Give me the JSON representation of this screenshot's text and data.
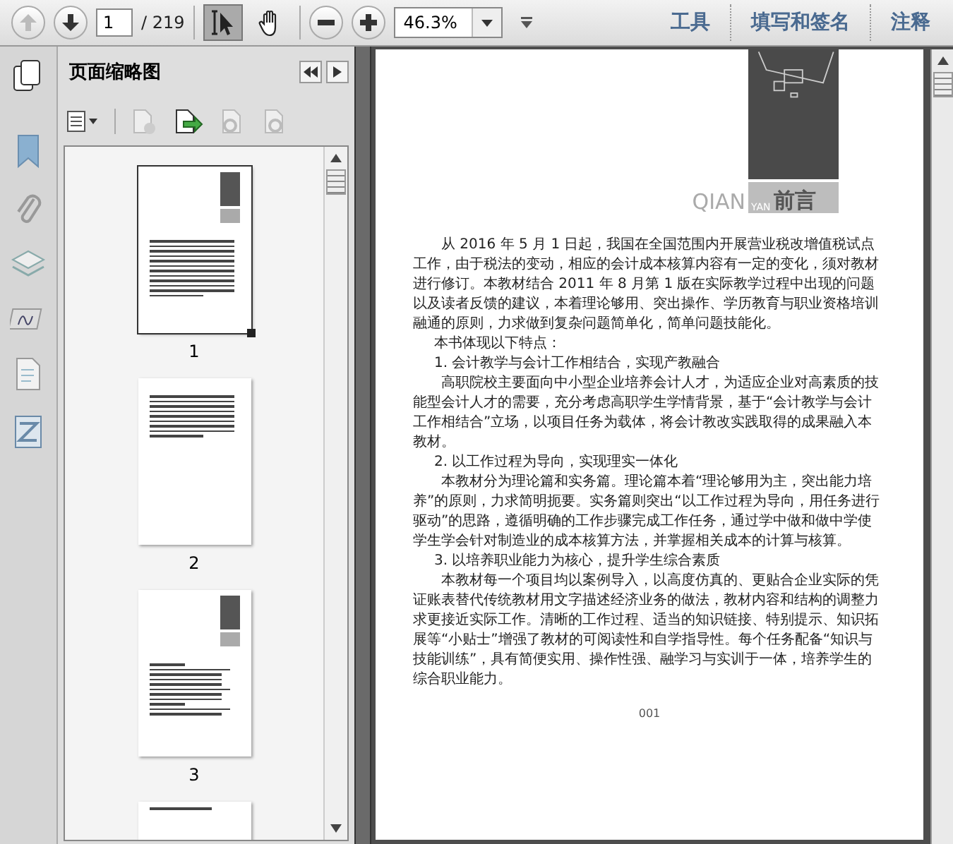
{
  "toolbar": {
    "page_number": "1",
    "page_total": "/ 219",
    "zoom": "46.3%",
    "tools": [
      {
        "kind": "select",
        "selected": true
      },
      {
        "kind": "hand",
        "selected": false
      }
    ],
    "panels": [
      "工具",
      "填写和签名",
      "注释"
    ]
  },
  "sidebar": {
    "title": "页面缩略图",
    "nav_icons": [
      {
        "kind": "bookmark"
      },
      {
        "kind": "attachment"
      },
      {
        "kind": "layers"
      },
      {
        "kind": "signature"
      },
      {
        "kind": "document"
      },
      {
        "kind": "compare"
      }
    ],
    "thumbnails": [
      {
        "kind": "cover",
        "label": "1",
        "selected": true
      },
      {
        "kind": "text",
        "label": "2",
        "selected": false
      },
      {
        "kind": "toc",
        "label": "3",
        "selected": false
      },
      {
        "kind": "partial",
        "selected": false
      }
    ]
  },
  "page": {
    "pinyin_large": "QIAN",
    "pinyin_small": "YAN",
    "heading": "前言",
    "paragraphs": [
      {
        "kind": "body",
        "text": "从 2016 年 5 月 1 日起，我国在全国范围内开展营业税改增值税试点工作，由于税法的变动，相应的会计成本核算内容有一定的变化，须对教材进行修订。本教材结合 2011 年 8 月第 1 版在实际教学过程中出现的问题以及读者反馈的建议，本着理论够用、突出操作、学历教育与职业资格培训融通的原则，力求做到复杂问题简单化，简单问题技能化。"
      },
      {
        "kind": "heading",
        "text": "本书体现以下特点："
      },
      {
        "kind": "heading",
        "text": "1. 会计教学与会计工作相结合，实现产教融合"
      },
      {
        "kind": "body",
        "text": "高职院校主要面向中小型企业培养会计人才，为适应企业对高素质的技能型会计人才的需要，充分考虑高职学生学情背景，基于“会计教学与会计工作相结合”立场，以项目任务为载体，将会计教改实践取得的成果融入本教材。"
      },
      {
        "kind": "heading",
        "text": "2. 以工作过程为导向，实现理实一体化"
      },
      {
        "kind": "body",
        "text": "本教材分为理论篇和实务篇。理论篇本着“理论够用为主，突出能力培养”的原则，力求简明扼要。实务篇则突出“以工作过程为导向，用任务进行驱动”的思路，遵循明确的工作步骤完成工作任务，通过学中做和做中学使学生学会针对制造业的成本核算方法，并掌握相关成本的计算与核算。"
      },
      {
        "kind": "heading",
        "text": "3. 以培养职业能力为核心，提升学生综合素质"
      },
      {
        "kind": "body",
        "text": "本教材每一个项目均以案例导入，以高度仿真的、更贴合企业实际的凭证账表替代传统教材用文字描述经济业务的做法，教材内容和结构的调整力求更接近实际工作。清晰的工作过程、适当的知识链接、特别提示、知识拓展等“小贴士”增强了教材的可阅读性和自学指导性。每个任务配备“知识与技能训练”，具有简便实用、操作性强、融学习与实训于一体，培养学生的综合职业能力。"
      }
    ],
    "page_number": "001"
  }
}
